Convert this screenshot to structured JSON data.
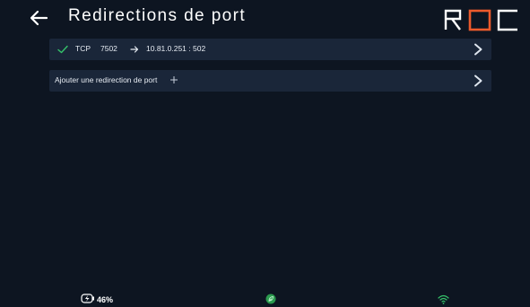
{
  "header": {
    "title": "Redirections de port",
    "logo_text": "ROC",
    "logo_colors": {
      "primary": "#ffffff",
      "accent": "#ec5a2c"
    }
  },
  "redirections": [
    {
      "status_icon": "check-icon",
      "protocol": "TCP",
      "port": "7502",
      "arrow_icon": "arrow-right-icon",
      "destination": "10.81.0.251 : 502"
    }
  ],
  "add_redirection": {
    "label": "Ajouter une redirection de port",
    "icon": "plus-icon"
  },
  "status_bar": {
    "battery_icon": "battery-charging-icon",
    "battery_percent": "46%",
    "center_icon": "leaf-icon",
    "wifi_icon": "wifi-icon"
  },
  "colors": {
    "background": "#0d1521",
    "row_background": "#1a2639",
    "accent_green": "#35c26a",
    "logo_orange": "#ec5a2c"
  }
}
